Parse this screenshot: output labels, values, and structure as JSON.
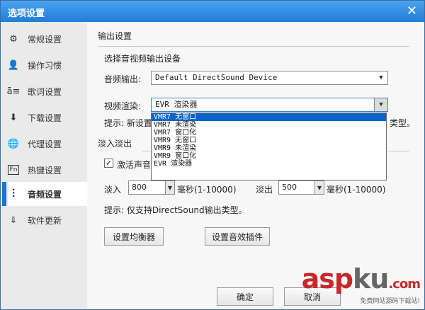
{
  "window": {
    "title": "选项设置",
    "close_glyph": "✕"
  },
  "sidebar": {
    "items": [
      {
        "label": "常规设置",
        "icon": "⚙",
        "active": false
      },
      {
        "label": "操作习惯",
        "icon": "👤",
        "active": false
      },
      {
        "label": "歌词设置",
        "icon": "ā≡",
        "active": false
      },
      {
        "label": "下载设置",
        "icon": "⬇",
        "active": false
      },
      {
        "label": "代理设置",
        "icon": "🌐",
        "active": false
      },
      {
        "label": "热键设置",
        "icon": "Fn",
        "active": false
      },
      {
        "label": "音频设置",
        "icon": "⫶",
        "active": true
      },
      {
        "label": "软件更新",
        "icon": "⇓",
        "active": false
      }
    ]
  },
  "output": {
    "section_title": "输出设置",
    "device_heading": "选择音视频输出设备",
    "audio_label": "音频输出:",
    "audio_value": "Default DirectSound Device",
    "video_label": "视频渲染:",
    "video_value": "EVR 渲染器",
    "hint_prefix": "提示: 新设置",
    "hint_suffix": "类型。",
    "video_options": [
      "VMR7 无窗口",
      "VMR7 未渲染",
      "VMR7 窗口化",
      "VMR9 无窗口",
      "VMR9 未渲染",
      "VMR9 窗口化",
      "EVR 渲染器"
    ],
    "selected_index": 0
  },
  "fade": {
    "section_title": "淡入淡出",
    "checkbox_label": "激活声音淡",
    "checked": true,
    "fade_in_label": "淡入",
    "fade_in_value": "800",
    "fade_in_unit": "毫秒(1-10000)",
    "fade_out_label": "淡出",
    "fade_out_value": "500",
    "fade_out_unit": "毫秒(1-10000)",
    "hint": "提示: 仅支持DirectSound输出类型。"
  },
  "buttons": {
    "equalizer": "设置均衡器",
    "effects": "设置音效插件",
    "ok": "确定",
    "cancel": "取消"
  },
  "watermark": {
    "logo_a": "asp",
    "logo_b": "ku",
    "logo_c": ".com",
    "sub": "免费网站源码下载站!"
  },
  "colors": {
    "titlebar": "#1f7ed9",
    "active_marker": "#1a73d9",
    "selection": "#0a64c8",
    "watermark": "#c8282c"
  }
}
